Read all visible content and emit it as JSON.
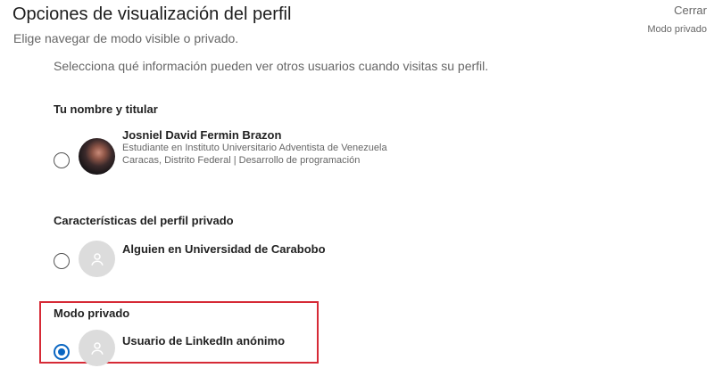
{
  "header": {
    "title": "Opciones de visualización del perfil",
    "subtitle": "Elige navegar de modo visible o privado.",
    "close_label": "Cerrar",
    "current_mode": "Modo privado"
  },
  "intro": "Selecciona qué información pueden ver otros usuarios cuando visitas su perfil.",
  "options": [
    {
      "section_title": "Tu nombre y titular",
      "name": "Josniel David Fermin Brazon",
      "line1": "Estudiante en Instituto Universitario Adventista de Venezuela",
      "line2": "Caracas, Distrito Federal | Desarrollo de programación",
      "selected": false,
      "avatar": "profile-photo"
    },
    {
      "section_title": "Características del perfil privado",
      "name": "Alguien en Universidad de Carabobo",
      "selected": false,
      "avatar": "person-icon"
    },
    {
      "section_title": "Modo privado",
      "name": "Usuario de LinkedIn anónimo",
      "selected": true,
      "avatar": "person-icon"
    }
  ],
  "colors": {
    "accent": "#0a66c2",
    "highlight": "#d62a36"
  }
}
